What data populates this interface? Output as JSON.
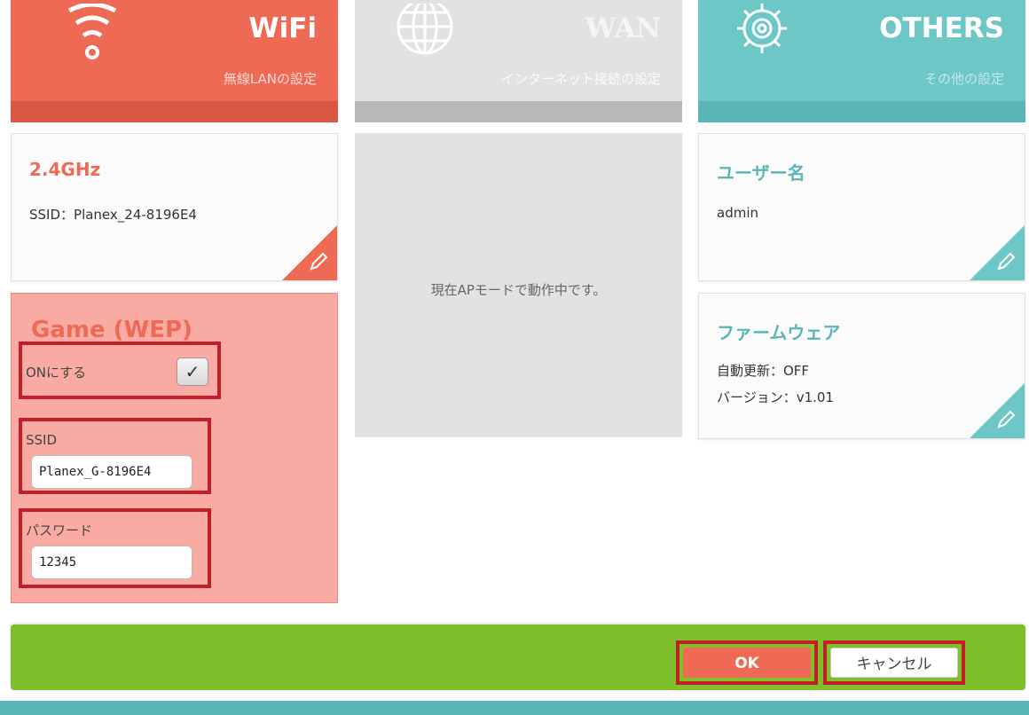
{
  "headers": {
    "wifi": {
      "title": "WiFi",
      "subtitle": "無線LANの設定",
      "icon": "wifi-icon"
    },
    "wan": {
      "title": "WAN",
      "subtitle": "インターネット接続の設定",
      "icon": "globe-icon"
    },
    "others": {
      "title": "OTHERS",
      "subtitle": "その他の設定",
      "icon": "gear-icon"
    }
  },
  "cards": {
    "wifi24": {
      "title": "2.4GHz",
      "ssid_line": "SSID：Planex_24-8196E4"
    },
    "username": {
      "title": "ユーザー名",
      "value": "admin"
    },
    "firmware": {
      "title": "ファームウェア",
      "auto_update": "自動更新：OFF",
      "version": "バージョン：v1.01"
    }
  },
  "wan": {
    "message": "現在APモードで動作中です。"
  },
  "game": {
    "title": "Game (WEP)",
    "enable_label": "ONにする",
    "enable_checked": true,
    "ssid_label": "SSID",
    "ssid_value": "Planex_G-8196E4",
    "password_label": "パスワード",
    "password_value": "12345"
  },
  "footer": {
    "ok_label": "OK",
    "cancel_label": "キャンセル"
  },
  "colors": {
    "wifi": "#ee6a55",
    "wan": "#e2e2e2",
    "others": "#6cc7c6",
    "footer": "#7fbf2b",
    "highlight": "#c21e26"
  }
}
